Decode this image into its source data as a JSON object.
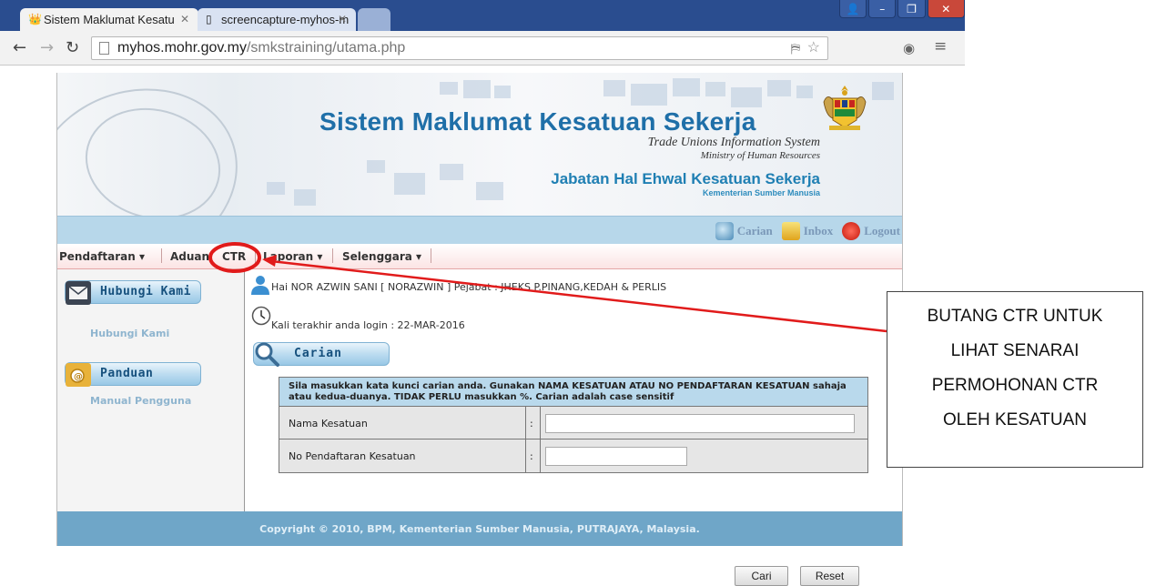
{
  "browser": {
    "tabs": [
      {
        "label": "Sistem Maklumat Kesatu",
        "active": true
      },
      {
        "label": "screencapture-myhos-m",
        "active": false
      }
    ],
    "url_host": "myhos.mohr.gov.my",
    "url_path": "/smkstraining/utama.php"
  },
  "banner": {
    "title": "Sistem Maklumat Kesatuan Sekerja",
    "subtitle_en": "Trade Unions Information System",
    "ministry_en": "Ministry of Human Resources",
    "department": "Jabatan Hal Ehwal Kesatuan Sekerja",
    "ministry_ms": "Kementerian Sumber Manusia"
  },
  "topbar": {
    "search_label": "Carian",
    "inbox_label": "Inbox",
    "logout_label": "Logout"
  },
  "menu": {
    "pendaftaran": "Pendaftaran",
    "aduan": "Aduan",
    "ctr": "CTR",
    "laporan": "Laporan",
    "selenggara": "Selenggara"
  },
  "sidebar": {
    "hubungi_button": "Hubungi Kami",
    "hubungi_link": "Hubungi Kami",
    "panduan_button": "Panduan",
    "panduan_link": "Manual Pengguna"
  },
  "main": {
    "greeting": "Hai NOR AZWIN SANI [ NORAZWIN ] Pejabat : JHEKS P.PINANG,KEDAH & PERLIS",
    "last_login": "Kali terakhir anda login : 22-MAR-2016",
    "search_header": "Carian",
    "instructions": "Sila masukkan kata kunci carian anda. Gunakan NAMA KESATUAN ATAU NO PENDAFTARAN KESATUAN sahaja atau kedua-duanya. TIDAK PERLU masukkan %. Carian adalah case sensitif",
    "field1_label": "Nama Kesatuan",
    "field2_label": "No Pendaftaran Kesatuan",
    "colon": ":",
    "field1_value": "",
    "field2_value": "",
    "search_button": "Cari",
    "reset_button": "Reset"
  },
  "footer": {
    "text": "Copyright © 2010, BPM, Kementerian Sumber Manusia, PUTRAJAYA, Malaysia."
  },
  "annotation": {
    "lines": [
      "BUTANG CTR UNTUK",
      "LIHAT SENARAI",
      "PERMOHONAN CTR",
      "OLEH KESATUAN"
    ],
    "color": "#e11b1b"
  }
}
